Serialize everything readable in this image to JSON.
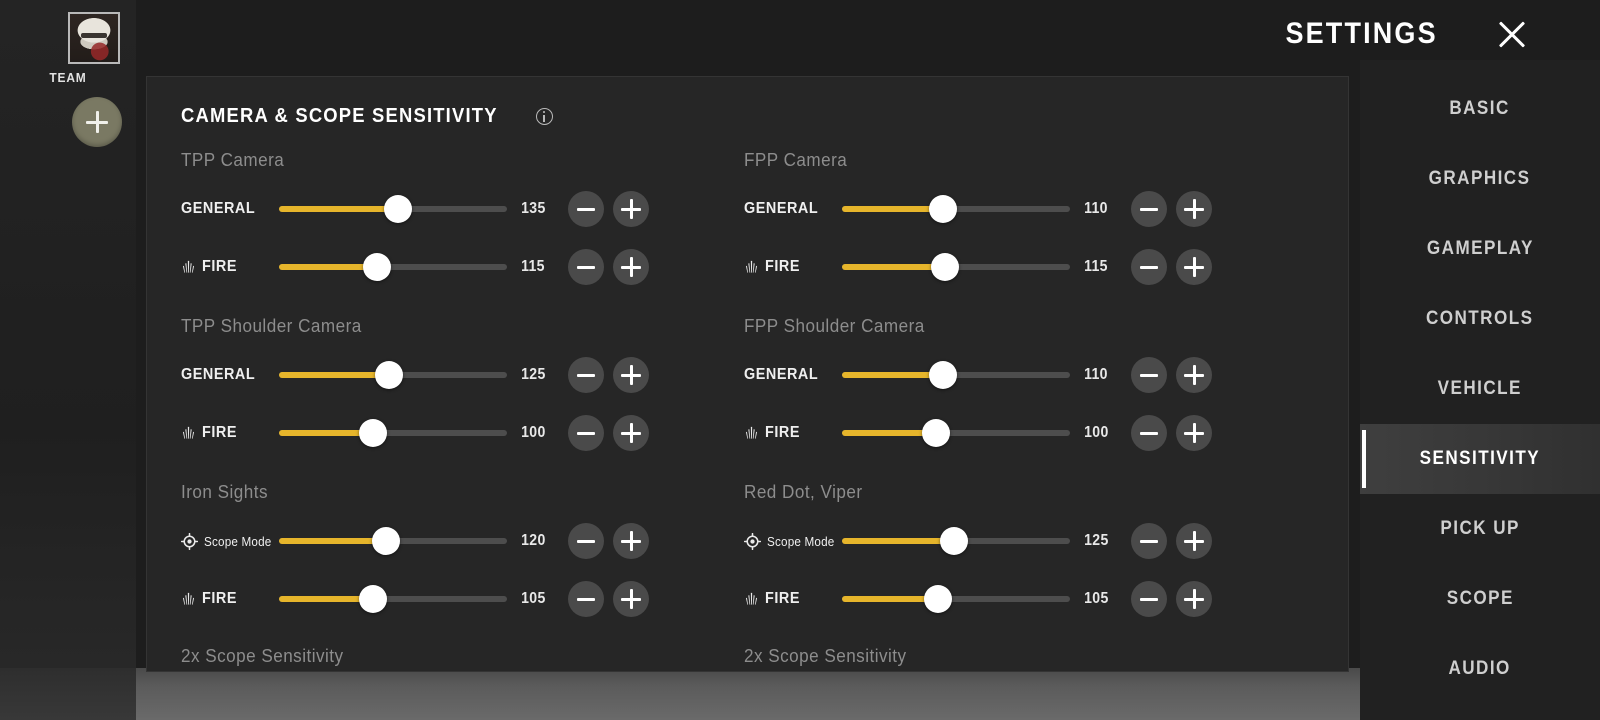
{
  "team_rail": {
    "avatar_name": "player-avatar",
    "team_label": "TEAM",
    "add_button_label": "+"
  },
  "header": {
    "title": "SETTINGS",
    "close_label": "✕"
  },
  "panel": {
    "title": "CAMERA & SCOPE SENSITIVITY",
    "info_tooltip": "i"
  },
  "columns": [
    {
      "groups": [
        {
          "title": "TPP Camera",
          "rows": [
            {
              "label": "GENERAL",
              "icon": "none",
              "value": "135",
              "percent": 46,
              "minus": "−",
              "plus": "+"
            },
            {
              "label": "FIRE",
              "icon": "fire",
              "value": "115",
              "percent": 37,
              "minus": "−",
              "plus": "+"
            }
          ]
        },
        {
          "title": "TPP Shoulder Camera",
          "rows": [
            {
              "label": "GENERAL",
              "icon": "none",
              "value": "125",
              "percent": 42,
              "minus": "−",
              "plus": "+"
            },
            {
              "label": "FIRE",
              "icon": "fire",
              "value": "100",
              "percent": 35,
              "minus": "−",
              "plus": "+"
            }
          ]
        },
        {
          "title": "Iron Sights",
          "rows": [
            {
              "label": "Scope Mode",
              "icon": "scope",
              "value": "120",
              "percent": 41,
              "minus": "−",
              "plus": "+"
            },
            {
              "label": "FIRE",
              "icon": "fire",
              "value": "105",
              "percent": 35,
              "minus": "−",
              "plus": "+"
            }
          ]
        }
      ],
      "clipped_title": "2x Scope Sensitivity"
    },
    {
      "groups": [
        {
          "title": "FPP Camera",
          "rows": [
            {
              "label": "GENERAL",
              "icon": "none",
              "value": "110",
              "percent": 38,
              "minus": "−",
              "plus": "+"
            },
            {
              "label": "FIRE",
              "icon": "fire",
              "value": "115",
              "percent": 39,
              "minus": "−",
              "plus": "+"
            }
          ]
        },
        {
          "title": "FPP Shoulder Camera",
          "rows": [
            {
              "label": "GENERAL",
              "icon": "none",
              "value": "110",
              "percent": 38,
              "minus": "−",
              "plus": "+"
            },
            {
              "label": "FIRE",
              "icon": "fire",
              "value": "100",
              "percent": 35,
              "minus": "−",
              "plus": "+"
            }
          ]
        },
        {
          "title": "Red Dot, Viper",
          "rows": [
            {
              "label": "Scope Mode",
              "icon": "scope",
              "value": "125",
              "percent": 43,
              "minus": "−",
              "plus": "+"
            },
            {
              "label": "FIRE",
              "icon": "fire",
              "value": "105",
              "percent": 36,
              "minus": "−",
              "plus": "+"
            }
          ]
        }
      ],
      "clipped_title": "2x Scope Sensitivity"
    }
  ],
  "nav": {
    "items": [
      {
        "label": "BASIC",
        "active": false
      },
      {
        "label": "GRAPHICS",
        "active": false
      },
      {
        "label": "GAMEPLAY",
        "active": false
      },
      {
        "label": "CONTROLS",
        "active": false
      },
      {
        "label": "VEHICLE",
        "active": false
      },
      {
        "label": "SENSITIVITY",
        "active": true
      },
      {
        "label": "PICK UP",
        "active": false
      },
      {
        "label": "SCOPE",
        "active": false
      },
      {
        "label": "AUDIO",
        "active": false
      }
    ]
  },
  "colors": {
    "accent_yellow": "#e6b52b",
    "panel_bg": "#262626",
    "nav_bg": "#212121",
    "track": "#4d4d4d",
    "knob": "#ffffff",
    "add_button": "#7a7963",
    "active_text": "#ffffff"
  }
}
